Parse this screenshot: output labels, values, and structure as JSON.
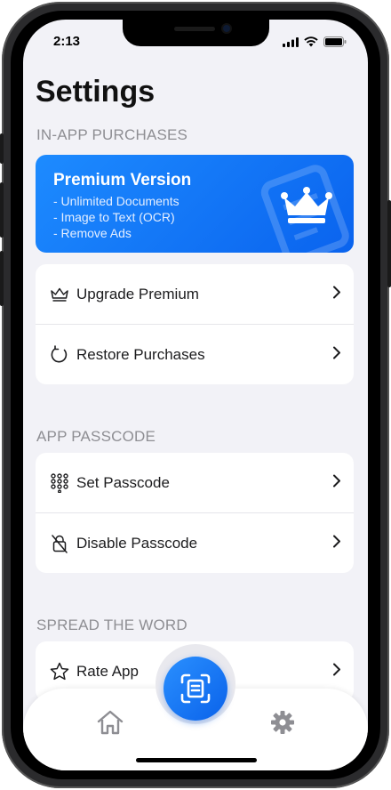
{
  "status_bar": {
    "time": "2:13"
  },
  "page": {
    "title": "Settings"
  },
  "sections": {
    "purchases": "IN-APP PURCHASES",
    "passcode": "APP PASSCODE",
    "spread": "SPREAD THE WORD"
  },
  "premium_card": {
    "title": "Premium Version",
    "features": [
      "- Unlimited Documents",
      "- Image to Text (OCR)",
      "- Remove Ads"
    ]
  },
  "purchase_rows": [
    {
      "label": "Upgrade Premium",
      "icon": "crown-icon"
    },
    {
      "label": "Restore Purchases",
      "icon": "restore-icon"
    }
  ],
  "passcode_rows": [
    {
      "label": "Set Passcode",
      "icon": "keypad-icon"
    },
    {
      "label": "Disable Passcode",
      "icon": "lock-slash-icon"
    }
  ],
  "spread_rows": [
    {
      "label": "Rate App",
      "icon": "star-icon"
    }
  ],
  "tabbar": {
    "home_icon": "house-icon",
    "scan_icon": "scan-document-icon",
    "settings_icon": "gear-icon"
  },
  "colors": {
    "accent": "#0a63ee",
    "background": "#f2f2f7",
    "section_label": "#8e8e93"
  }
}
